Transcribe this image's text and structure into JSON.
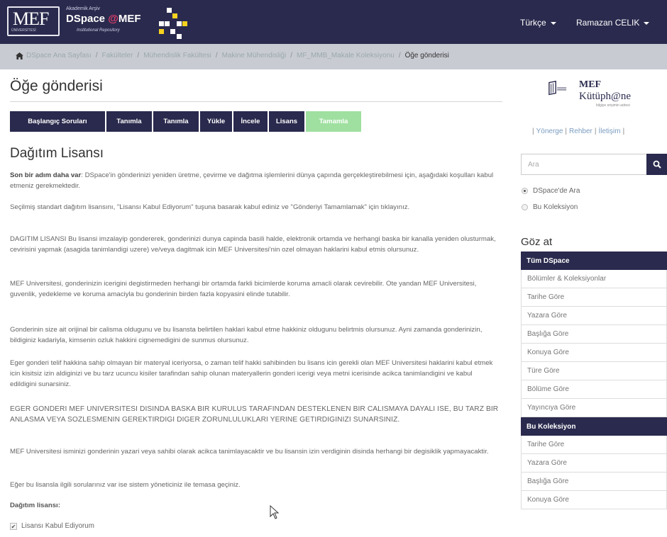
{
  "header": {
    "logo_text": "MEF",
    "logo_subtitle": "ÜNİVERSİTESİ",
    "brand_tagline": "Akademik Arşiv",
    "brand_name_prefix": "DSpace",
    "brand_name_at": "@",
    "brand_name_suffix": "MEF",
    "brand_subtitle": "Institutional Repository",
    "language": "Türkçe",
    "user": "Ramazan CELIK",
    "colors": {
      "bar": "#2a2a4e",
      "accent": "#e0406a"
    }
  },
  "breadcrumb": {
    "items": [
      "DSpace Ana Sayfası",
      "Fakülteler",
      "Mühendislik Fakültesi",
      "Makine Mühendisliği",
      "MF_MMB_Makale Koleksiyonu"
    ],
    "current": "Öğe gönderisi",
    "separator": "/"
  },
  "main": {
    "title": "Öğe gönderisi",
    "steps": [
      {
        "label": "Başlangıç Soruları"
      },
      {
        "label": "Tanımla"
      },
      {
        "label": "Tanımla"
      },
      {
        "label": "Yükle"
      },
      {
        "label": "İncele"
      },
      {
        "label": "Lisans"
      },
      {
        "label": "Tamamla"
      }
    ],
    "active_step": "Tamamla",
    "section_title": "Dağıtım Lisansı",
    "intro_bold": "Son bir adım daha var",
    "intro_rest": ": DSpace'in gönderinizi yeniden üretme, çevirme ve dağıtma işlemlerini dünya çapında gerçekleştirebilmesi için, aşağıdaki koşulları kabul etmeniz gerekmektedir.",
    "p2": "Seçilmiş standart dağıtım lisansını, \"Lisansı Kabul Ediyorum\" tuşuna basarak kabul ediniz ve \"Gönderiyi Tamamlamak\" için tıklayınız.",
    "p3": "DAGITIM LISANSI Bu lisansi imzalayip gondererek, gonderinizi dunya capinda basili halde, elektronik ortamda ve herhangi baska bir kanalla yeniden olusturmak, cevirisini yapmak (asagida tanimlandigi uzere) ve/veya dagitmak icin MEF Universitesi'nin ozel olmayan haklarini kabul etmis olursunuz.",
    "p4": "MEF Universitesi, gonderinizin icerigini degistirmeden herhangi bir ortamda farkli bicimlerde koruma amacli olarak cevirebilir. Ote yandan MEF Universitesi, guvenlik, yedekleme ve koruma amaciyla bu gonderinin birden fazla kopyasini elinde tutabilir.",
    "p5": "Gonderinin size ait orijinal bir calisma oldugunu ve bu lisansta belirtilen haklari kabul etme hakkiniz oldugunu belirtmis olursunuz. Ayni zamanda gonderinizin, bildiginiz kadariyla, kimsenin ozluk hakkini cignemedigini de sunmus olursunuz.",
    "p6": "Eger gonderi telif hakkina sahip olmayan bir materyal iceriyorsa, o zaman telif hakki sahibinden bu lisans icin gerekli olan MEF Universitesi haklarini kabul etmek icin kisitsiz izin aldiginizi ve bu tarz ucuncu kisiler tarafindan sahip olunan materyallerin gonderi icerigi veya metni icerisinde acikca tanimlandigini ve kabul edildigini sunarsiniz.",
    "p7": "EGER GONDERI MEF UNIVERSITESI DISINDA BASKA BIR KURULUS TARAFINDAN DESTEKLENEN BIR CALISMAYA DAYALI ISE, BU TARZ BIR ANLASMA VEYA SOZLESMENIN GEREKTIRDIGI DIGER ZORUNLULUKLARI YERINE GETIRDIGINIZI SUNARSINIZ.",
    "p8": "MEF Universitesi isminizi gonderinin yazari veya sahibi olarak acikca tanimlayacaktir ve bu lisansin izin verdiginin disinda herhangi bir degisiklik yapmayacaktir.",
    "p9": "Eğer bu lisansla ilgili sorularınız var ise sistem yöneticiniz ile temasa geçiniz.",
    "license_label": "Dağıtım lisansı:",
    "accept_label": "Lisansı Kabul Ediyorum",
    "accept_checked": true
  },
  "sidebar": {
    "library_name_1": "MEF",
    "library_name_2": "Kütüph@ne",
    "library_tagline": "bilgiye erişimin adresi",
    "links": [
      "Yönerge",
      "Rehber",
      "İletişim"
    ],
    "search_placeholder": "Ara",
    "scope_options": [
      "DSpace'de Ara",
      "Bu Koleksiyon"
    ],
    "scope_selected": "DSpace'de Ara",
    "browse_title": "Göz at",
    "browse_all_header": "Tüm DSpace",
    "browse_all_items": [
      "Bölümler & Koleksiyonlar",
      "Tarihe Göre",
      "Yazara Göre",
      "Başlığa Göre",
      "Konuya Göre",
      "Türe Göre",
      "Bölüme Göre",
      "Yayıncıya Göre"
    ],
    "browse_coll_header": "Bu Koleksiyon",
    "browse_coll_items": [
      "Tarihe Göre",
      "Yazara Göre",
      "Başlığa Göre",
      "Konuya Göre"
    ]
  }
}
